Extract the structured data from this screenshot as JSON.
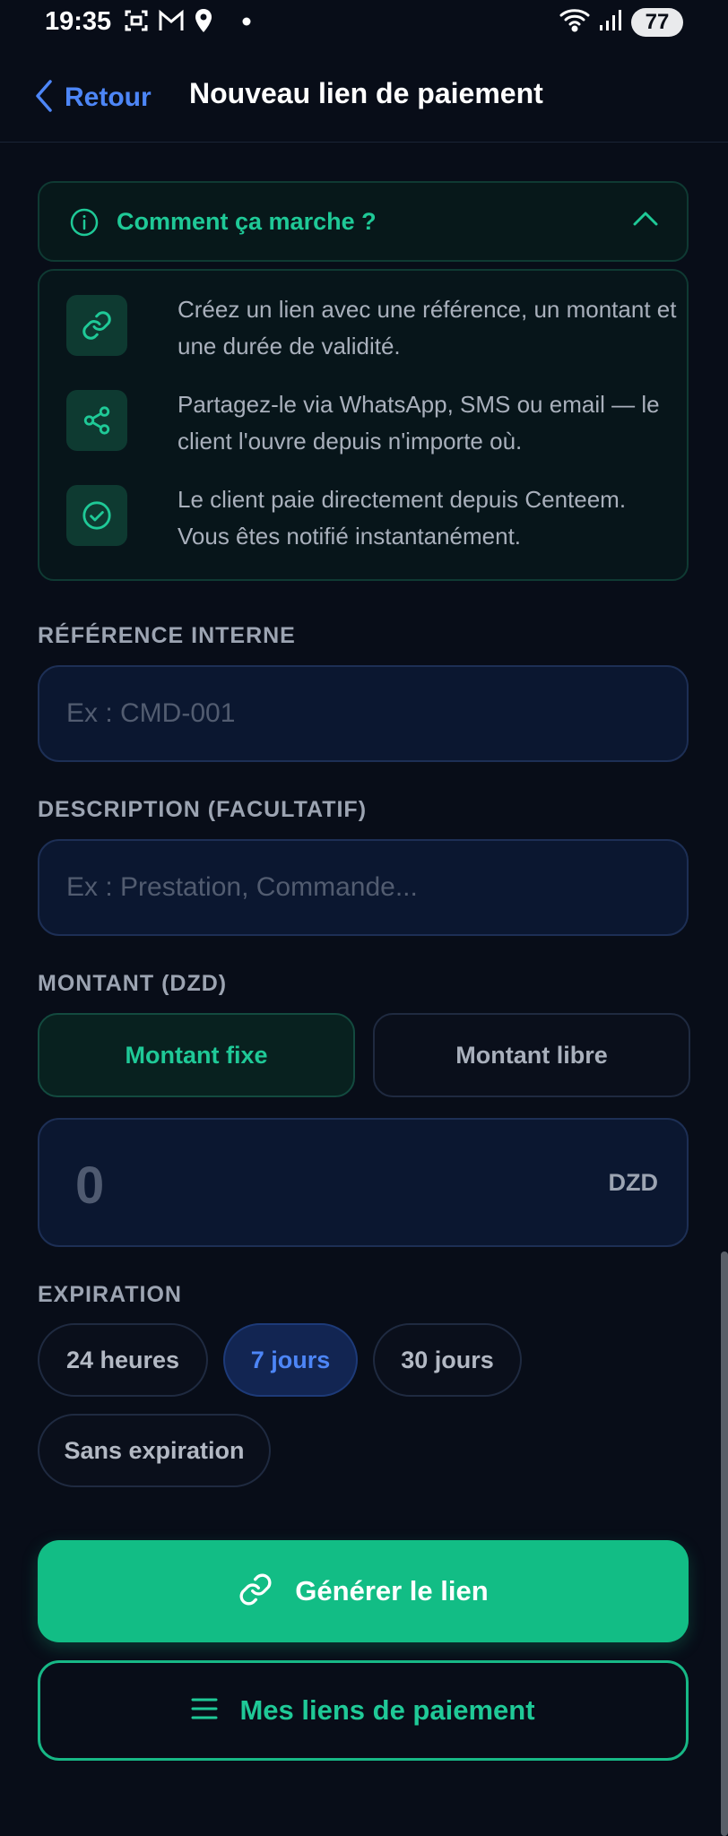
{
  "status_bar": {
    "time": "19:35",
    "battery": "77",
    "left_icons": [
      "screenshot-icon",
      "gmail-icon",
      "location-icon",
      "dot-icon"
    ],
    "right_icons": [
      "wifi-icon",
      "signal-icon",
      "battery-icon"
    ]
  },
  "nav": {
    "back_label": "Retour",
    "title": "Nouveau lien de paiement"
  },
  "info": {
    "title": "Comment ça marche ?",
    "steps": [
      {
        "icon": "link-icon",
        "text": "Créez un lien avec une référence, un montant et une durée de validité."
      },
      {
        "icon": "share-icon",
        "text": "Partagez-le via WhatsApp, SMS ou email — le client l'ouvre depuis n'importe où."
      },
      {
        "icon": "check-circle-icon",
        "text": "Le client paie directement depuis Centeem. Vous êtes notifié instantanément."
      }
    ]
  },
  "form": {
    "reference": {
      "label": "RÉFÉRENCE INTERNE",
      "placeholder": "Ex : CMD-001",
      "value": ""
    },
    "description": {
      "label": "DESCRIPTION (FACULTATIF)",
      "placeholder": "Ex : Prestation, Commande...",
      "value": ""
    },
    "amount": {
      "label": "MONTANT (DZD)",
      "modes": [
        "Montant fixe",
        "Montant libre"
      ],
      "selected_mode": "Montant fixe",
      "value": "0",
      "currency": "DZD"
    },
    "expiration": {
      "label": "EXPIRATION",
      "options": [
        "24 heures",
        "7 jours",
        "30 jours",
        "Sans expiration"
      ],
      "selected": "7 jours"
    }
  },
  "actions": {
    "generate_label": "Générer le lien",
    "my_links_label": "Mes liens de paiement"
  },
  "colors": {
    "background": "#080d18",
    "accent_green": "#1fc997",
    "primary_button": "#12bd85",
    "accent_blue": "#4d86f7",
    "field_bg": "#0b1730"
  }
}
